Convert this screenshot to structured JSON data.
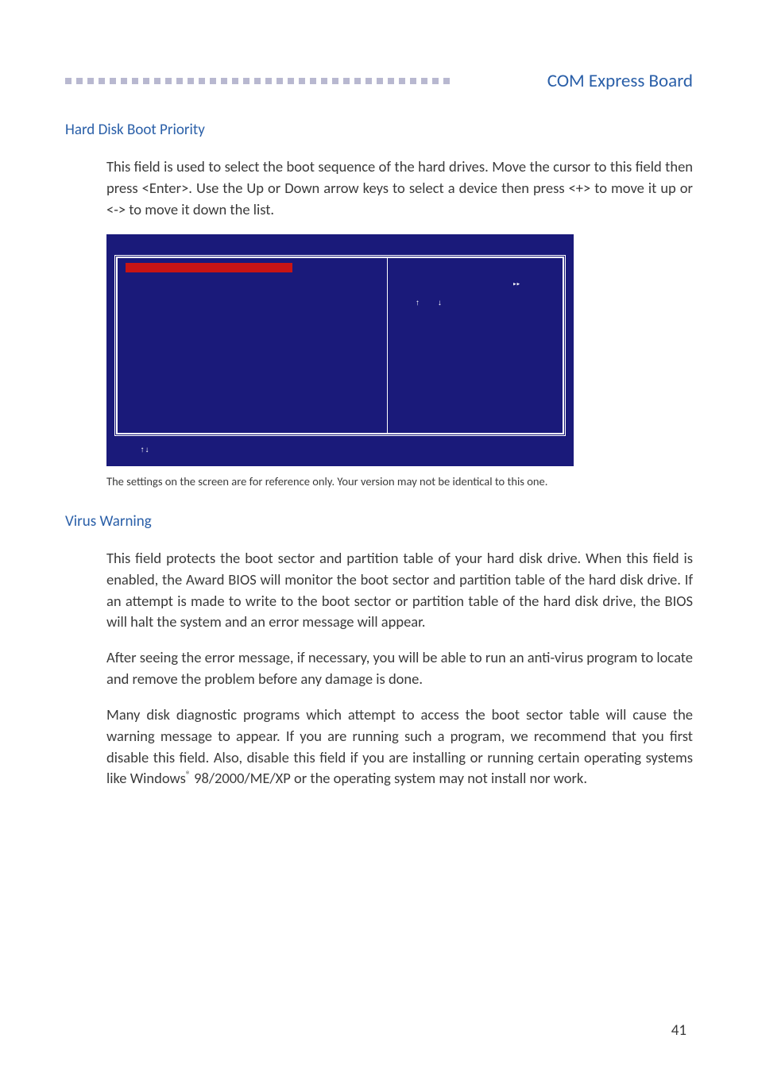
{
  "header": {
    "title": "COM Express Board"
  },
  "section1": {
    "heading": "Hard Disk Boot Priority",
    "para1": "This field is used to select the boot sequence of the hard drives. Move the cursor to this field then press <Enter>. Use the Up or Down arrow keys to select a device then press <+> to move it up or <-> to move it down the list."
  },
  "bios": {
    "up": "↑",
    "down": "↓",
    "play": "▸▸",
    "footer_arrows": "↑↓"
  },
  "caption": "The settings on the screen are for reference only. Your version may not be identical to this one.",
  "section2": {
    "heading": "Virus Warning",
    "para1": "This field protects the boot sector and partition table of your hard disk drive. When this field is enabled, the Award BIOS will monitor the boot sector and partition table of the hard disk drive. If an attempt is made to write to the boot sector or partition table of the hard disk drive, the BIOS will halt the system and an error message will appear.",
    "para2": "After seeing the error message, if necessary, you will be able to run an anti-virus program to locate and remove the problem before any damage is done.",
    "para3_a": "Many disk diagnostic programs which attempt to access the boot sector table will cause the warning message to appear. If you are running such a program, we recommend that you first disable this field. Also, disable this field if you are installing or running certain operating systems like Windows",
    "para3_reg": "®",
    "para3_b": " 98/2000/ME/XP or the operating system may not install nor work."
  },
  "page_number": "41"
}
